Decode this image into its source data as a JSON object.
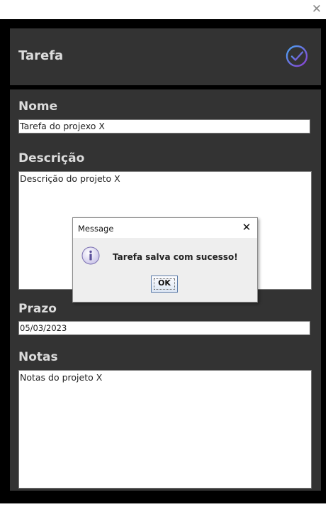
{
  "window": {
    "close_icon": "close-icon"
  },
  "header": {
    "title": "Tarefa",
    "confirm_icon": "check-circle-icon"
  },
  "form": {
    "name_label": "Nome",
    "name_value": "Tarefa do projexo X",
    "description_label": "Descrição",
    "description_value": "Descrição do projeto X",
    "deadline_label": "Prazo",
    "deadline_value": "05/03/2023",
    "notes_label": "Notas",
    "notes_value": "Notas do projeto X"
  },
  "dialog": {
    "title": "Message",
    "message": "Tarefa salva com sucesso!",
    "ok_label": "OK",
    "icon": "info-icon"
  },
  "colors": {
    "panel": "#333333",
    "frame": "#000000",
    "label_text": "#dcdcdc",
    "check_gradient_start": "#4aa3f0",
    "check_gradient_end": "#8a3fd0"
  }
}
